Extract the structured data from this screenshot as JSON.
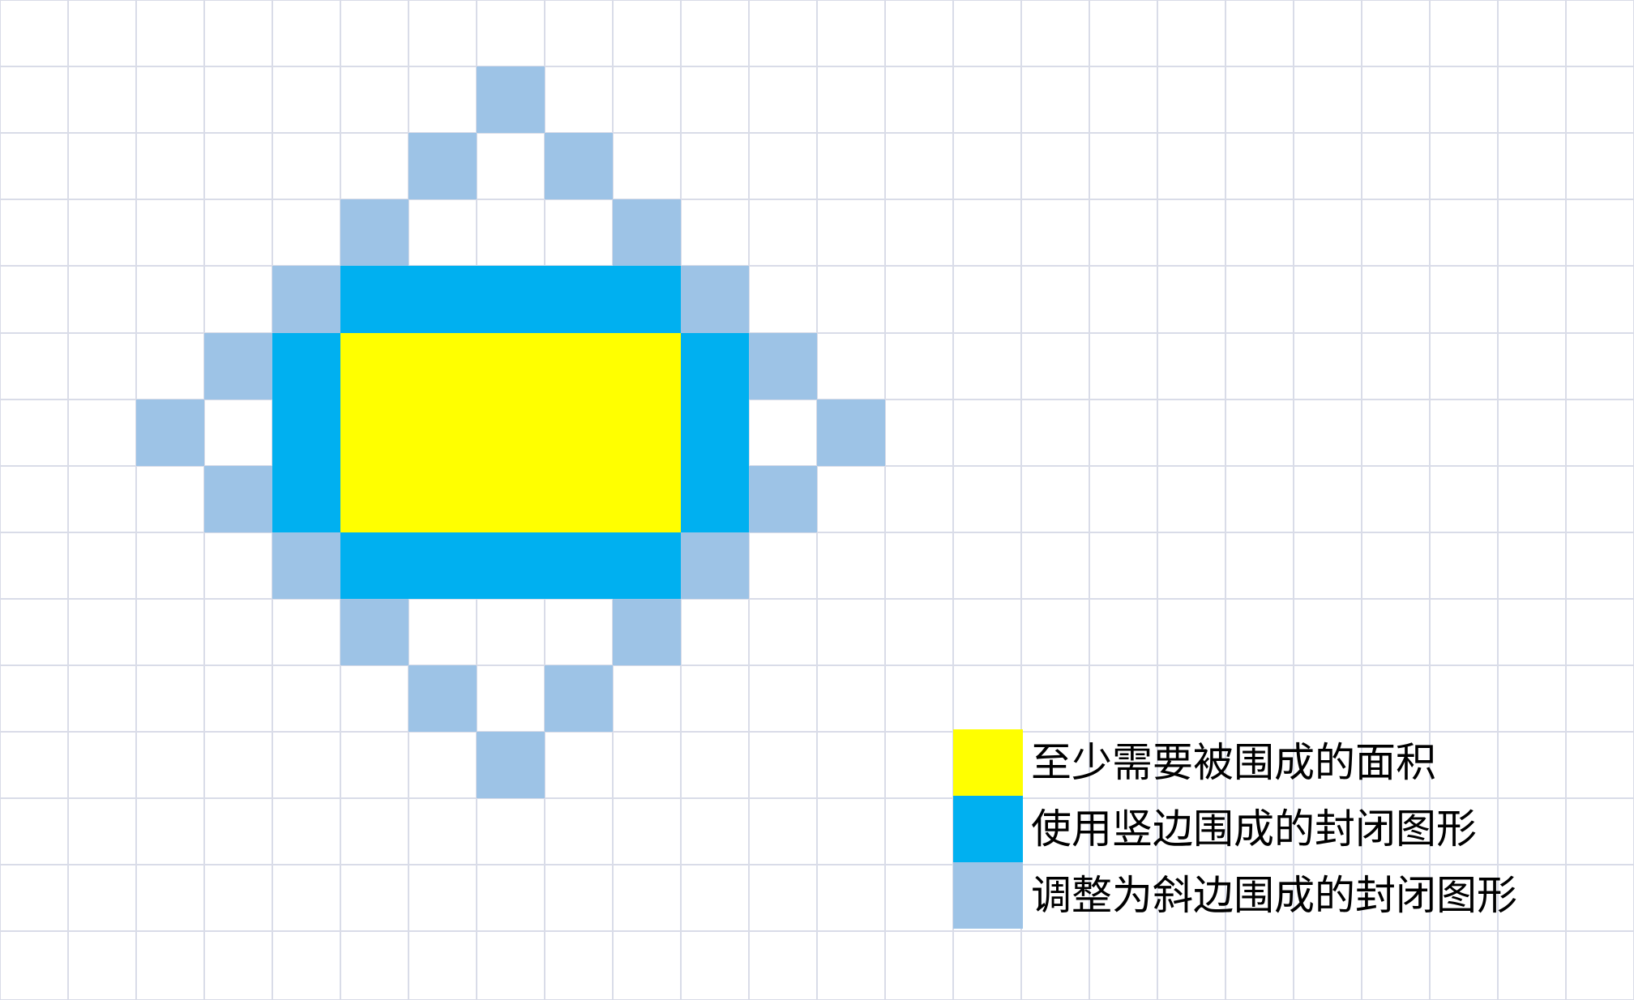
{
  "diagram": {
    "colors": {
      "background": "#ffffff",
      "grid": "#d9dce8",
      "required_area": "#ffff00",
      "vertical_enclosure": "#00b0f0",
      "diagonal_enclosure": "#9dc3e6"
    },
    "legend": [
      {
        "label": "至少需要被围成的面积",
        "color": "#ffff00"
      },
      {
        "label": "使用竖边围成的封闭图形",
        "color": "#00b0f0"
      },
      {
        "label": "调整为斜边围成的封闭图形",
        "color": "#9dc3e6"
      }
    ]
  }
}
